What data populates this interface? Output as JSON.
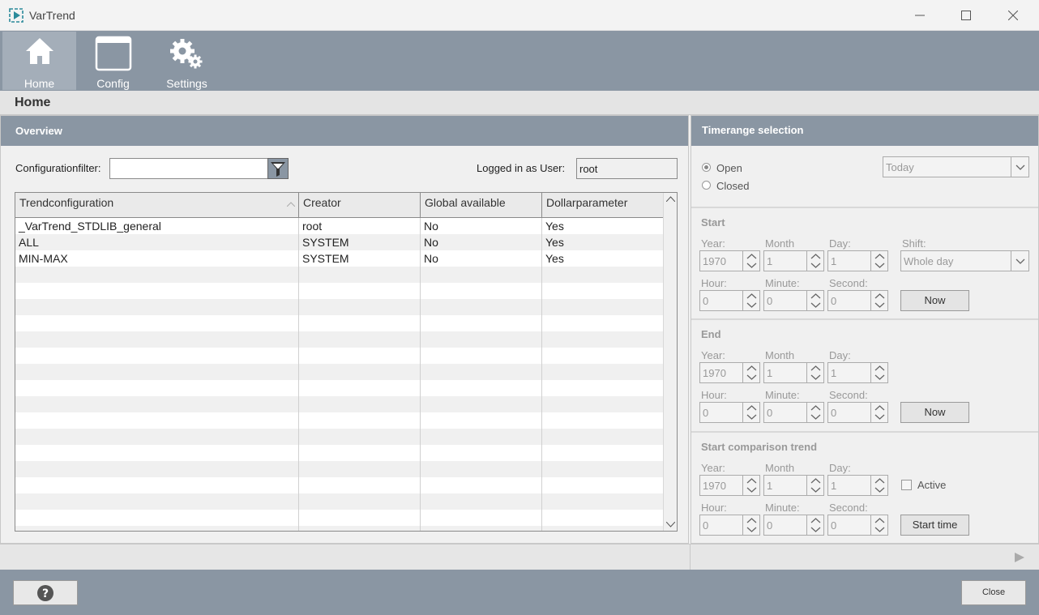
{
  "window": {
    "title": "VarTrend"
  },
  "toolbar": {
    "items": [
      {
        "label": "Home"
      },
      {
        "label": "Config"
      },
      {
        "label": "Settings"
      }
    ]
  },
  "page": {
    "title": "Home"
  },
  "overview": {
    "title": "Overview",
    "filter_label": "Configurationfilter:",
    "filter_value": "",
    "logged_in_label": "Logged in as User:",
    "user": "root",
    "table": {
      "columns": [
        "Trendconfiguration",
        "Creator",
        "Global available",
        "Dollarparameter"
      ],
      "rows": [
        [
          "_VarTrend_STDLIB_general",
          "root",
          "No",
          "Yes"
        ],
        [
          "ALL",
          "SYSTEM",
          "No",
          "Yes"
        ],
        [
          "MIN-MAX",
          "SYSTEM",
          "No",
          "Yes"
        ]
      ]
    }
  },
  "timerange": {
    "title": "Timerange selection",
    "open_label": "Open",
    "closed_label": "Closed",
    "preset": "Today",
    "start": {
      "title": "Start",
      "year_label": "Year:",
      "month_label": "Month",
      "day_label": "Day:",
      "shift_label": "Shift:",
      "year": "1970",
      "month": "1",
      "day": "1",
      "shift": "Whole day",
      "hour_label": "Hour:",
      "minute_label": "Minute:",
      "second_label": "Second:",
      "hour": "0",
      "minute": "0",
      "second": "0",
      "now_label": "Now"
    },
    "end": {
      "title": "End",
      "year_label": "Year:",
      "month_label": "Month",
      "day_label": "Day:",
      "year": "1970",
      "month": "1",
      "day": "1",
      "hour_label": "Hour:",
      "minute_label": "Minute:",
      "second_label": "Second:",
      "hour": "0",
      "minute": "0",
      "second": "0",
      "now_label": "Now"
    },
    "comparison": {
      "title": "Start comparison trend",
      "year_label": "Year:",
      "month_label": "Month",
      "day_label": "Day:",
      "year": "1970",
      "month": "1",
      "day": "1",
      "active_label": "Active",
      "hour_label": "Hour:",
      "minute_label": "Minute:",
      "second_label": "Second:",
      "hour": "0",
      "minute": "0",
      "second": "0",
      "start_time_label": "Start time"
    }
  },
  "footer": {
    "help_label": "?",
    "close_label": "Close"
  }
}
